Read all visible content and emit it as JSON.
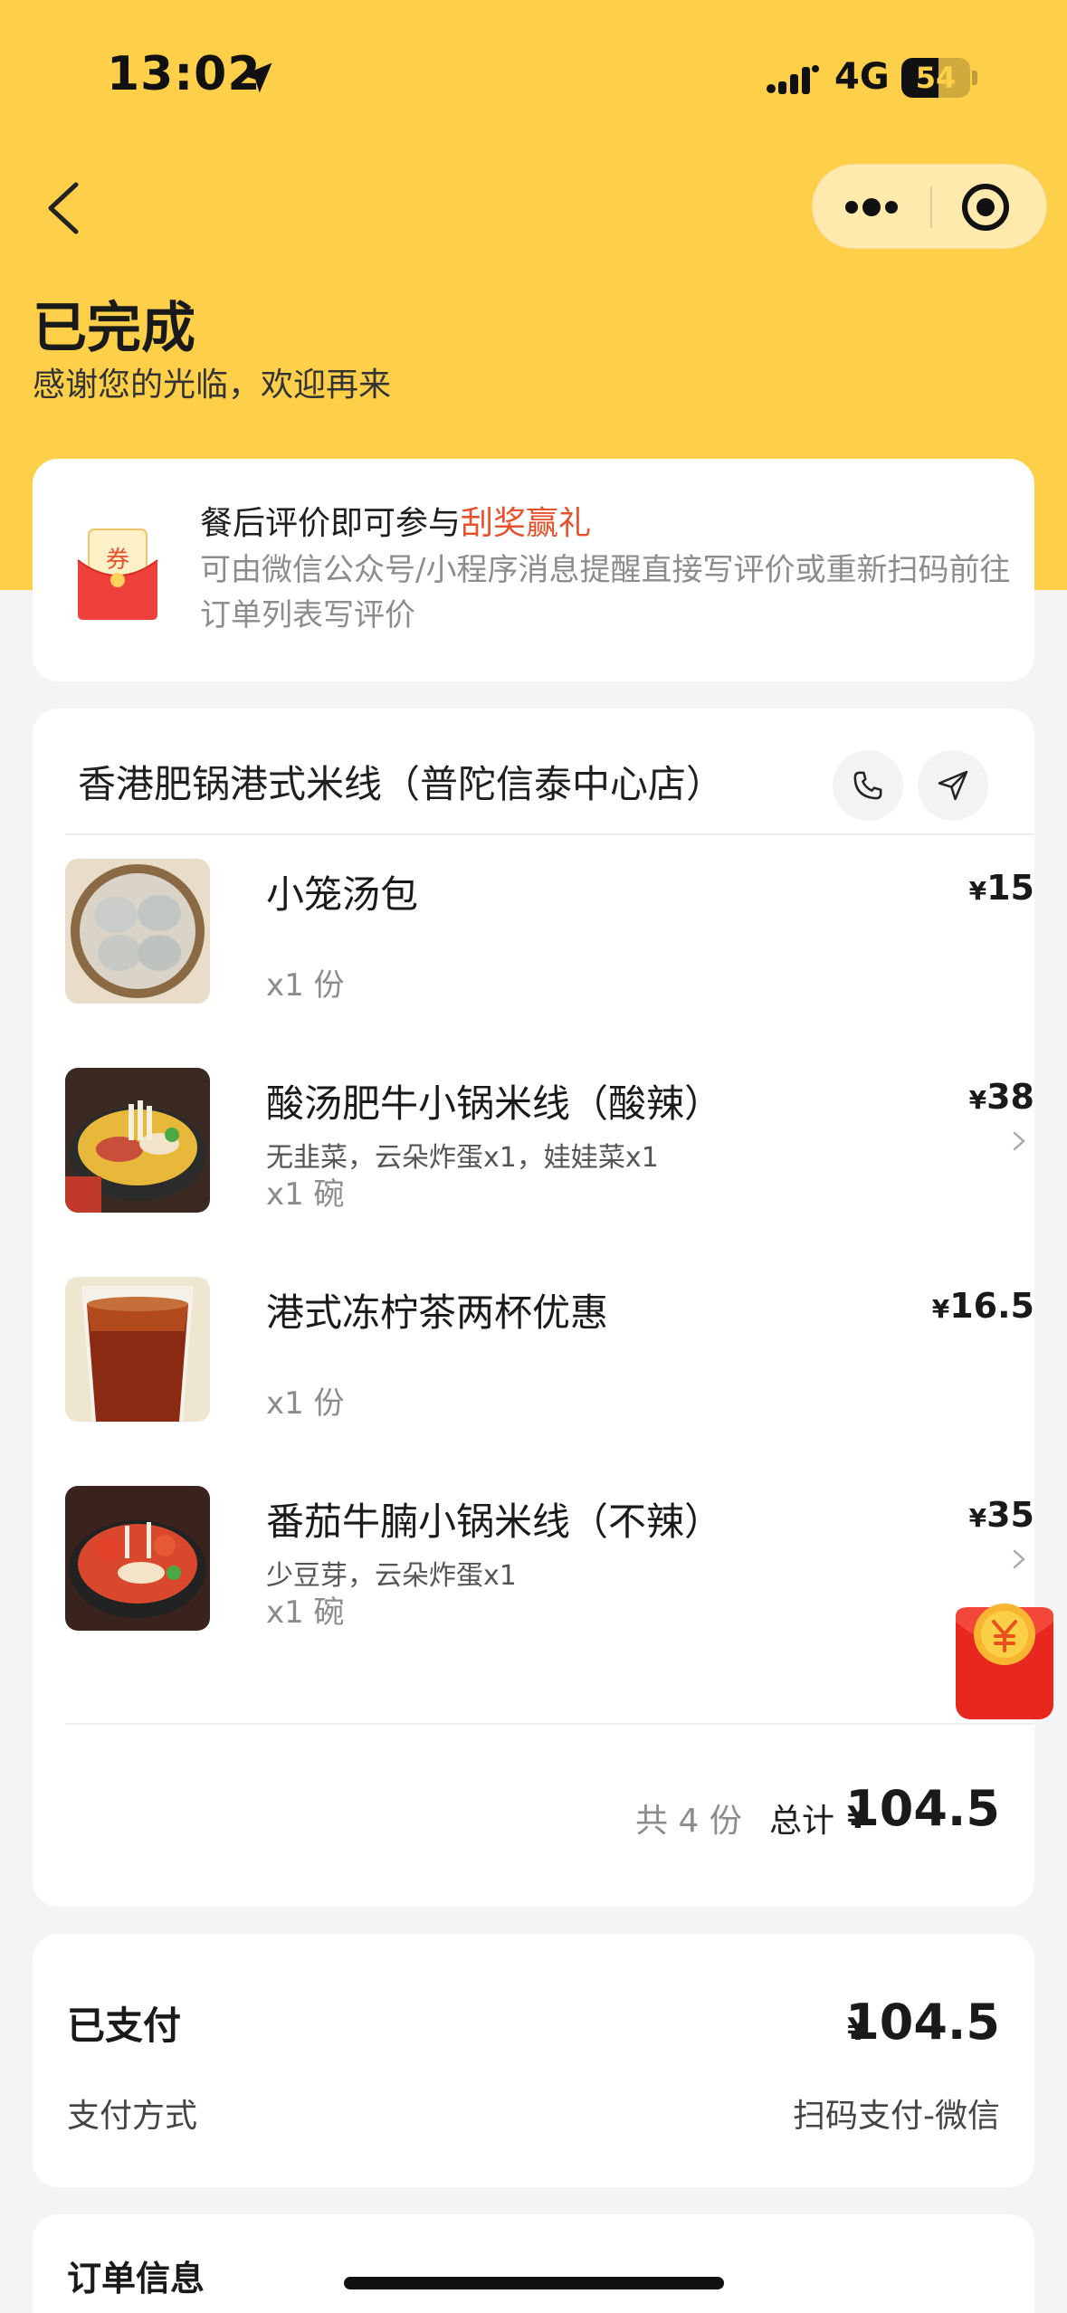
{
  "status_bar": {
    "time": "13:02",
    "network": "4G",
    "battery": "54",
    "battery_level": 0.54
  },
  "nav": {
    "back_icon": "chevron-left-icon",
    "more_icon": "more-dots-icon",
    "close_icon": "target-circle-icon"
  },
  "header": {
    "title": "已完成",
    "subtitle": "感谢您的光临，欢迎再来"
  },
  "review": {
    "title_prefix": "餐后评价即可参与",
    "title_highlight": "刮奖赢礼",
    "description": "可由微信公众号/小程序消息提醒直接写评价或重新扫码前往订单列表写评价",
    "icon_text": "券",
    "highlight_color": "#e8502c"
  },
  "order": {
    "store_name": "香港肥锅港式米线（普陀信泰中心店）",
    "items": [
      {
        "name": "小笼汤包",
        "spec": "",
        "qty": "x1 份",
        "price": "15",
        "has_detail": false
      },
      {
        "name": "酸汤肥牛小锅米线（酸辣）",
        "spec": "无韭菜，云朵炸蛋x1，娃娃菜x1",
        "qty": "x1 碗",
        "price": "38",
        "has_detail": true
      },
      {
        "name": "港式冻柠茶两杯优惠",
        "spec": "",
        "qty": "x1 份",
        "price": "16.5",
        "has_detail": false
      },
      {
        "name": "番茄牛腩小锅米线（不辣）",
        "spec": "少豆芽，云朵炸蛋x1",
        "qty": "x1 碗",
        "price": "35",
        "has_detail": true
      }
    ],
    "currency": "¥",
    "count_label": "共 4 份",
    "total_label": "总计",
    "total_value": "104.5"
  },
  "payment": {
    "paid_label": "已支付",
    "paid_value": "104.5",
    "method_label": "支付方式",
    "method_value": "扫码支付-微信"
  },
  "order_info": {
    "title": "订单信息"
  },
  "colors": {
    "header_bg": "#fed04a",
    "page_bg": "#f4f4f4",
    "accent": "#e8502c"
  }
}
